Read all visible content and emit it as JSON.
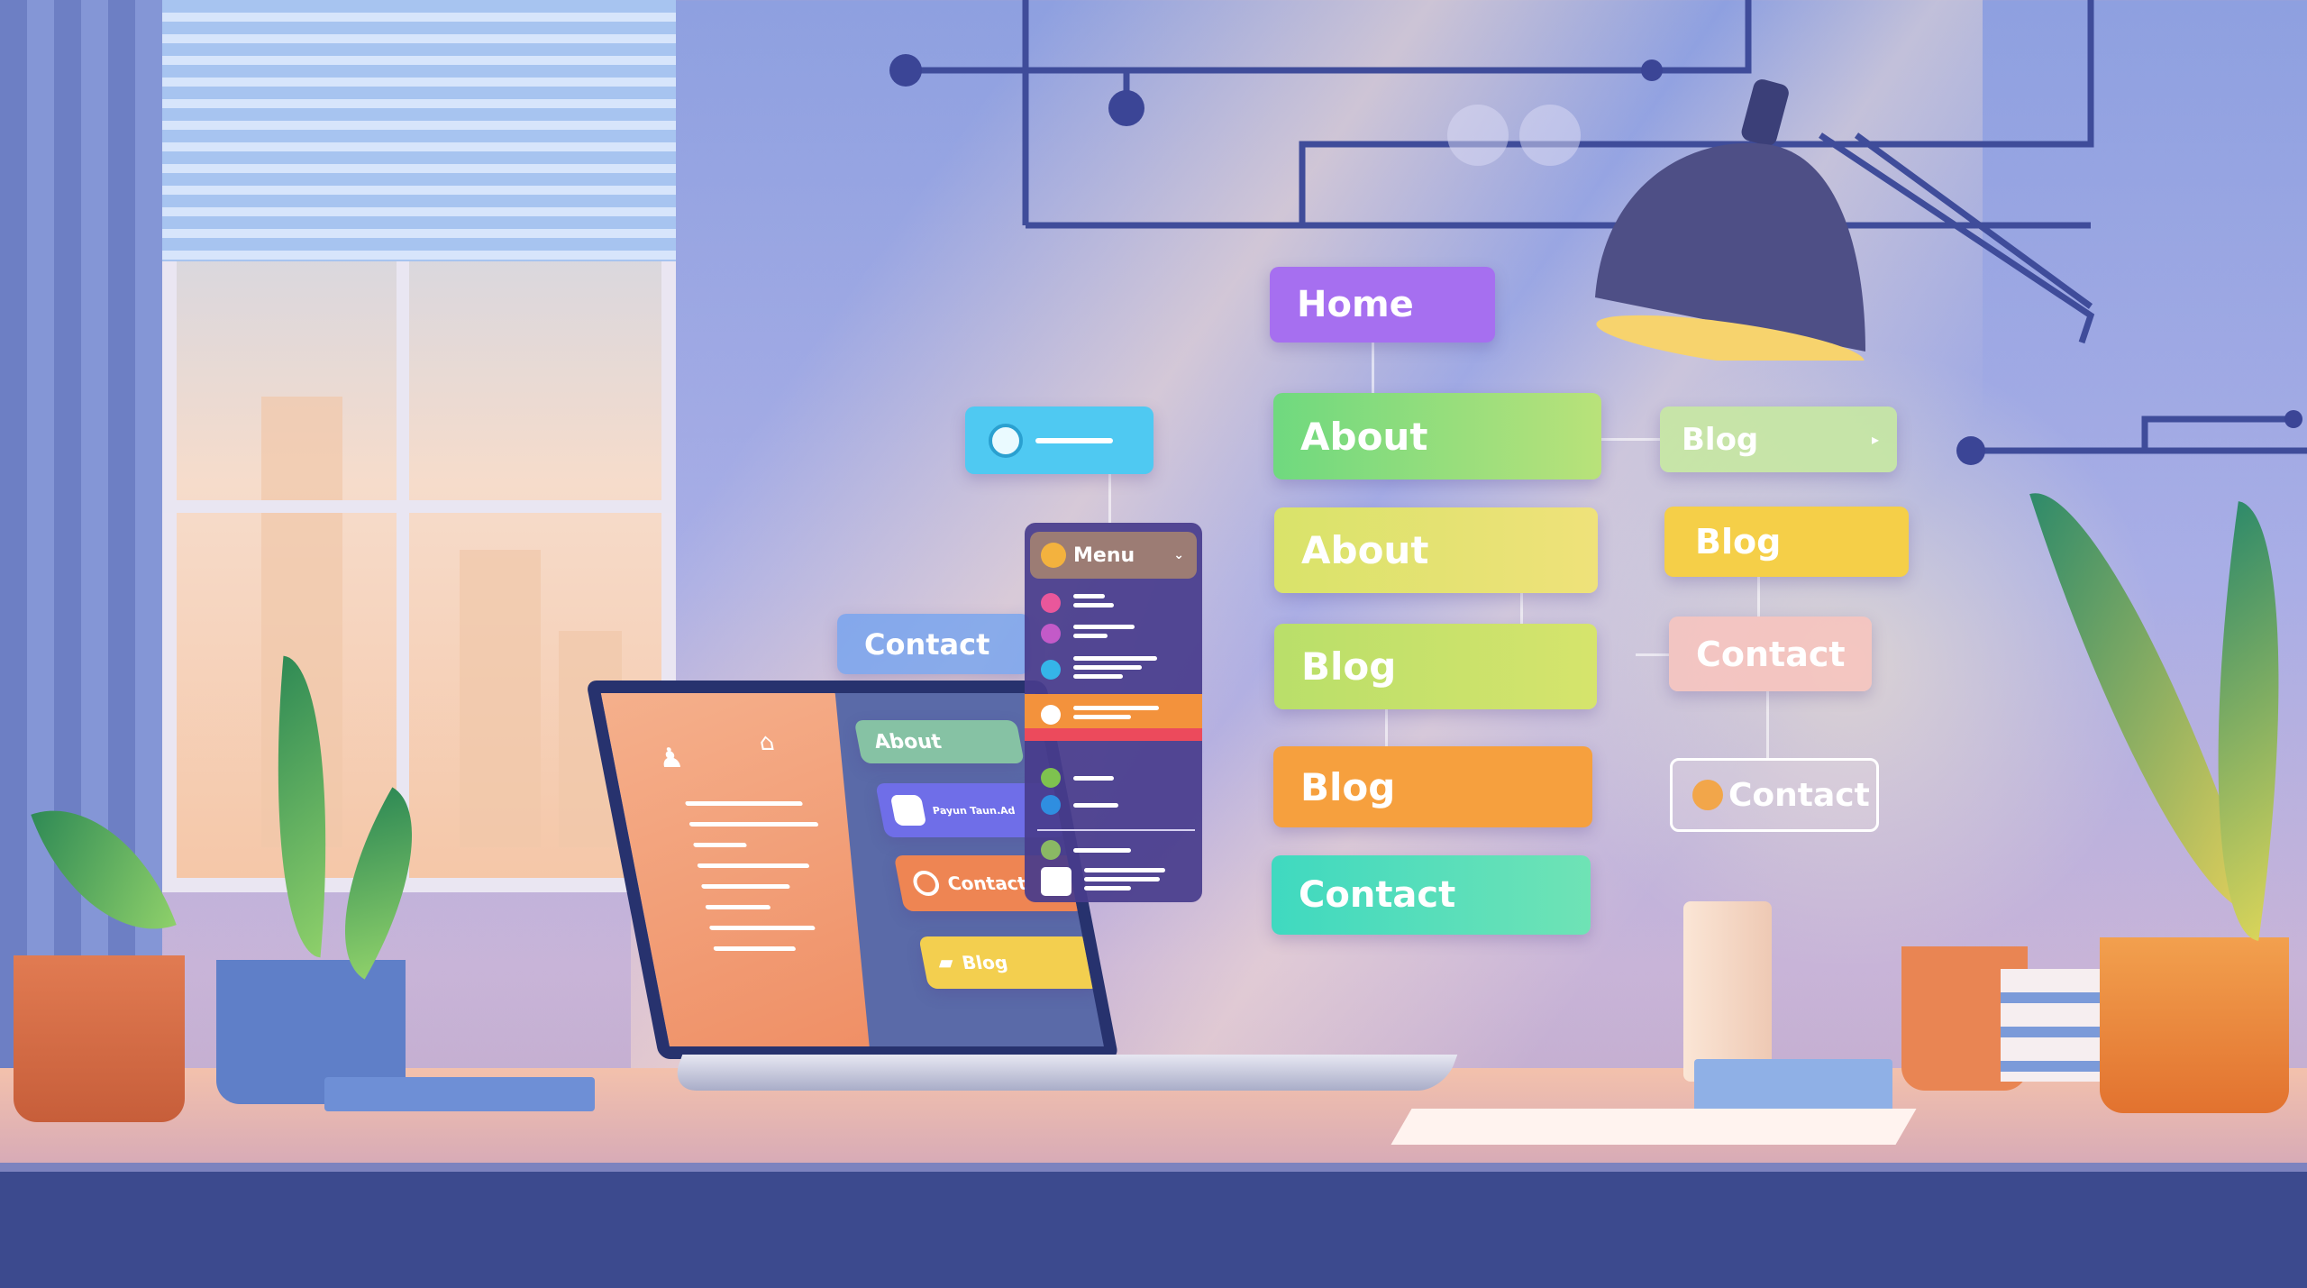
{
  "flowchart": {
    "column_main": [
      "Home",
      "About",
      "About",
      "Blog",
      "Blog",
      "Contact"
    ],
    "column_right": [
      "Blog",
      "Blog",
      "Contact",
      "Contact"
    ],
    "left_pill": "Contact",
    "colors": {
      "home": "#a66ff0",
      "about_green": "#6fd97f",
      "about_yellow": "#d9e36a",
      "blog_lime": "#b9df6a",
      "blog_orange": "#f6a03e",
      "contact_teal": "#3fd9c0",
      "blog_light": "#c6e8a2",
      "blog_yellow": "#f5cf48",
      "contact_pink": "#f6c4bf"
    }
  },
  "menu_panel": {
    "title": "Menu",
    "icons": [
      "pink-avatar",
      "purple-avatar",
      "twitter-bird",
      "home-circle",
      "green-icon",
      "blue-icon",
      "green-leaf",
      "user-card"
    ]
  },
  "laptop_screen": {
    "about": "About",
    "card_text": "Payun Taun.Ad",
    "contact": "Contact",
    "blog": "Blog"
  }
}
